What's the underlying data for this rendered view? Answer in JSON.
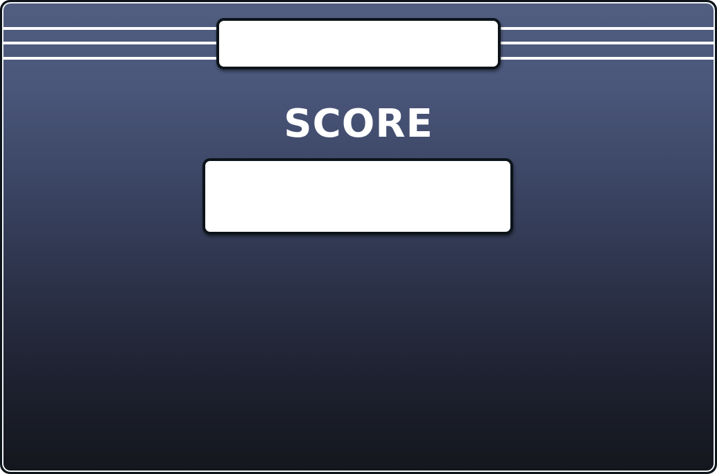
{
  "panel": {
    "title_text": "",
    "score_label": "SCORE",
    "score_value": ""
  },
  "colors": {
    "background_top": "#515e80",
    "background_bottom": "#14171d",
    "frame_border": "#0c141a",
    "box_fill": "#ffffff",
    "text": "#ffffff"
  }
}
